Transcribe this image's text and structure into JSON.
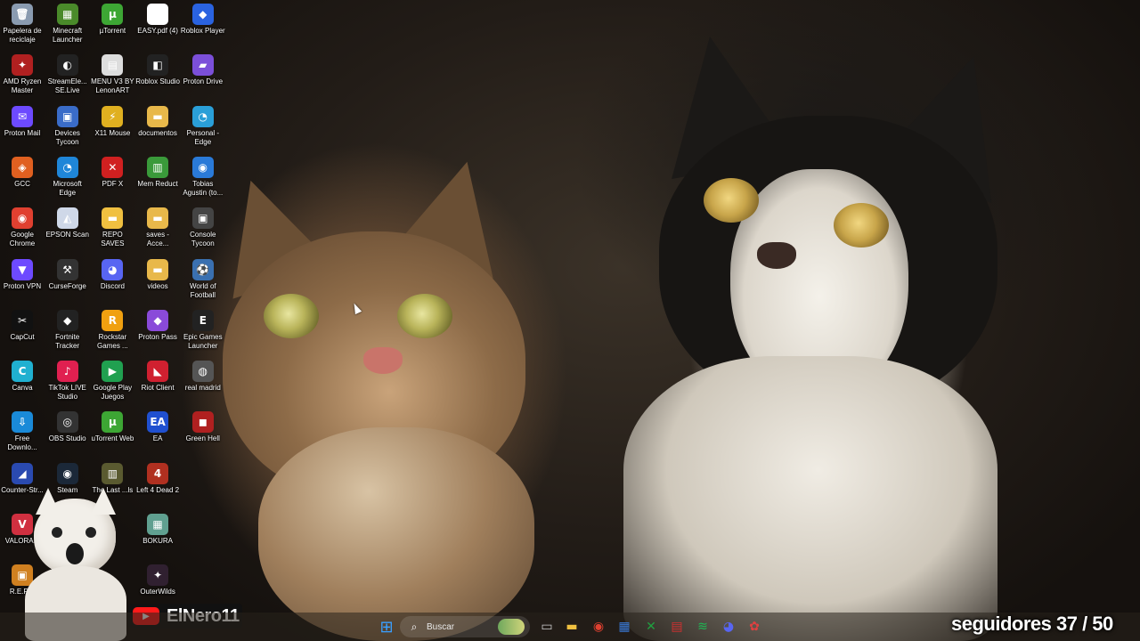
{
  "desktop": {
    "icons": [
      {
        "label": "Papelera de reciclaje",
        "glyph": "🗑",
        "color": "#8a9bb0"
      },
      {
        "label": "Minecraft Launcher",
        "glyph": "▦",
        "color": "#4a8a2a"
      },
      {
        "label": "µTorrent",
        "glyph": "µ",
        "color": "#3da634"
      },
      {
        "label": "EASY.pdf (4)",
        "glyph": "◉",
        "color": "#ffffff"
      },
      {
        "label": "Roblox Player",
        "glyph": "◆",
        "color": "#2a63e0"
      },
      {
        "label": "AMD Ryzen Master",
        "glyph": "✦",
        "color": "#b02020"
      },
      {
        "label": "StreamEle... SE.Live",
        "glyph": "◐",
        "color": "#222222"
      },
      {
        "label": "MENU V3 BY LenonART",
        "glyph": "▤",
        "color": "#dddddd"
      },
      {
        "label": "Roblox Studio",
        "glyph": "◧",
        "color": "#222222"
      },
      {
        "label": "Proton Drive",
        "glyph": "▰",
        "color": "#7b4fd9"
      },
      {
        "label": "Proton Mail",
        "glyph": "✉",
        "color": "#6d4aff"
      },
      {
        "label": "Devices Tycoon",
        "glyph": "▣",
        "color": "#3a6cc8"
      },
      {
        "label": "X11 Mouse",
        "glyph": "⚡",
        "color": "#e0b020"
      },
      {
        "label": "documentos",
        "glyph": "▬",
        "color": "#e8b84a"
      },
      {
        "label": "Personal - Edge",
        "glyph": "◔",
        "color": "#2a9fd8"
      },
      {
        "label": "GCC",
        "glyph": "◈",
        "color": "#e06020"
      },
      {
        "label": "Microsoft Edge",
        "glyph": "◔",
        "color": "#1f86d8"
      },
      {
        "label": "PDF X",
        "glyph": "✕",
        "color": "#d02020"
      },
      {
        "label": "Mem Reduct",
        "glyph": "▥",
        "color": "#3a9a3a"
      },
      {
        "label": "Tobias Agustin (to...",
        "glyph": "◉",
        "color": "#2a7ad8"
      },
      {
        "label": "Google Chrome",
        "glyph": "◉",
        "color": "#e04030"
      },
      {
        "label": "EPSON Scan",
        "glyph": "◭",
        "color": "#cfd8e8"
      },
      {
        "label": "REPO SAVES",
        "glyph": "▬",
        "color": "#f0c040"
      },
      {
        "label": "saves - Acce...",
        "glyph": "▬",
        "color": "#e8b84a"
      },
      {
        "label": "Console Tycoon",
        "glyph": "▣",
        "color": "#444444"
      },
      {
        "label": "Proton VPN",
        "glyph": "▼",
        "color": "#6d4aff"
      },
      {
        "label": "CurseForge",
        "glyph": "⚒",
        "color": "#333333"
      },
      {
        "label": "Discord",
        "glyph": "◕",
        "color": "#5865f2"
      },
      {
        "label": "videos",
        "glyph": "▬",
        "color": "#e8b84a"
      },
      {
        "label": "World of Football",
        "glyph": "⚽",
        "color": "#3a70b0"
      },
      {
        "label": "CapCut",
        "glyph": "✂",
        "color": "#111111"
      },
      {
        "label": "Fortnite Tracker",
        "glyph": "◆",
        "color": "#222222"
      },
      {
        "label": "Rockstar Games ...",
        "glyph": "R",
        "color": "#f0a010"
      },
      {
        "label": "Proton Pass",
        "glyph": "◆",
        "color": "#8a4ad9"
      },
      {
        "label": "Epic Games Launcher",
        "glyph": "E",
        "color": "#222222"
      },
      {
        "label": "Canva",
        "glyph": "C",
        "color": "#20b0d0"
      },
      {
        "label": "TikTok LIVE Studio",
        "glyph": "♪",
        "color": "#e02050"
      },
      {
        "label": "Google Play Juegos",
        "glyph": "▶",
        "color": "#20a050"
      },
      {
        "label": "Riot Client",
        "glyph": "◣",
        "color": "#d02030"
      },
      {
        "label": "real madrid",
        "glyph": "◍",
        "color": "#555555"
      },
      {
        "label": "Free Downlo...",
        "glyph": "⇩",
        "color": "#1a8ad8"
      },
      {
        "label": "OBS Studio",
        "glyph": "◎",
        "color": "#333333"
      },
      {
        "label": "uTorrent Web",
        "glyph": "µ",
        "color": "#3da634"
      },
      {
        "label": "EA",
        "glyph": "EA",
        "color": "#2050d0"
      },
      {
        "label": "Green Hell",
        "glyph": "◼",
        "color": "#b02020"
      },
      {
        "label": "Counter-Str...",
        "glyph": "◢",
        "color": "#2a4ab0"
      },
      {
        "label": "Steam",
        "glyph": "◉",
        "color": "#1b2838"
      },
      {
        "label": "The Last ...ls",
        "glyph": "▥",
        "color": "#5a5a30"
      },
      {
        "label": "Left 4 Dead 2",
        "glyph": "4",
        "color": "#b03020"
      },
      {
        "label": "VALORA...",
        "glyph": "V",
        "color": "#d03040"
      },
      {
        "label": "BOKURA",
        "glyph": "▦",
        "color": "#60a090"
      },
      {
        "label": "R.E.P.O",
        "glyph": "▣",
        "color": "#d08020"
      },
      {
        "label": "OuterWilds",
        "glyph": "✦",
        "color": "#302030"
      }
    ]
  },
  "taskbar": {
    "search_placeholder": "Buscar",
    "items": [
      {
        "name": "windows-start",
        "glyph": "⊞",
        "color": "#3aa0ff"
      },
      {
        "name": "task-view",
        "glyph": "▭",
        "color": "#cccccc"
      },
      {
        "name": "file-explorer",
        "glyph": "▬",
        "color": "#f0c040"
      },
      {
        "name": "chrome",
        "glyph": "◉",
        "color": "#e04030"
      },
      {
        "name": "ms-store",
        "glyph": "▦",
        "color": "#3a7ad8"
      },
      {
        "name": "xbox",
        "glyph": "✕",
        "color": "#20a040"
      },
      {
        "name": "recording-app",
        "glyph": "▤",
        "color": "#d03030"
      },
      {
        "name": "spotify",
        "glyph": "≋",
        "color": "#1db954"
      },
      {
        "name": "discord",
        "glyph": "◕",
        "color": "#5865f2"
      },
      {
        "name": "settings",
        "glyph": "✿",
        "color": "#e04040"
      }
    ]
  },
  "overlay": {
    "channel_name": "ElNero11",
    "followers_text": "seguidores 37 / 50"
  }
}
